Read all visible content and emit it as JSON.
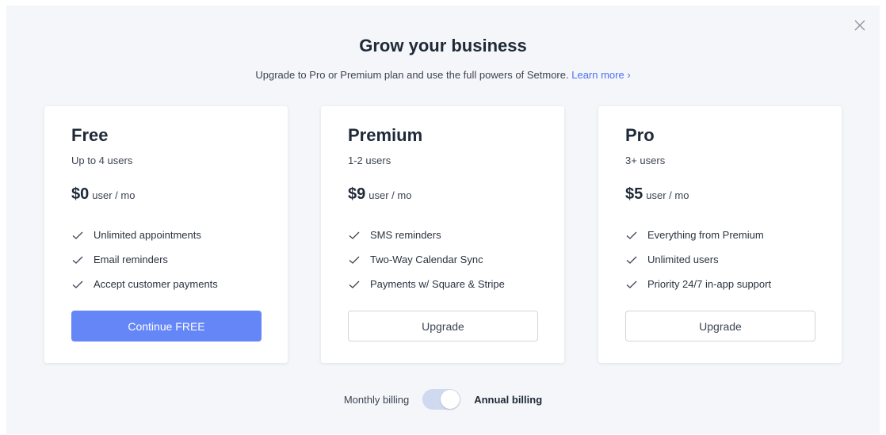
{
  "modal": {
    "title": "Grow your business",
    "subtitle": "Upgrade to Pro or Premium plan and use the full powers of Setmore.",
    "learn_more": "Learn more ›",
    "close_icon": "close-icon"
  },
  "plans": [
    {
      "name": "Free",
      "users": "Up to 4 users",
      "price": "$0",
      "unit": "user / mo",
      "features": [
        "Unlimited appointments",
        "Email reminders",
        "Accept customer payments"
      ],
      "button": "Continue FREE"
    },
    {
      "name": "Premium",
      "users": "1-2 users",
      "price": "$9",
      "unit": "user / mo",
      "features": [
        "SMS reminders",
        "Two-Way Calendar Sync",
        "Payments w/ Square & Stripe"
      ],
      "button": "Upgrade"
    },
    {
      "name": "Pro",
      "users": "3+ users",
      "price": "$5",
      "unit": "user / mo",
      "features": [
        "Everything from Premium",
        "Unlimited users",
        "Priority 24/7 in-app support"
      ],
      "button": "Upgrade"
    }
  ],
  "billing": {
    "monthly": "Monthly billing",
    "annual": "Annual billing",
    "annual_selected": true
  },
  "colors": {
    "accent": "#6586f7",
    "link": "#4d6ff5",
    "background": "#f4f6f9"
  }
}
